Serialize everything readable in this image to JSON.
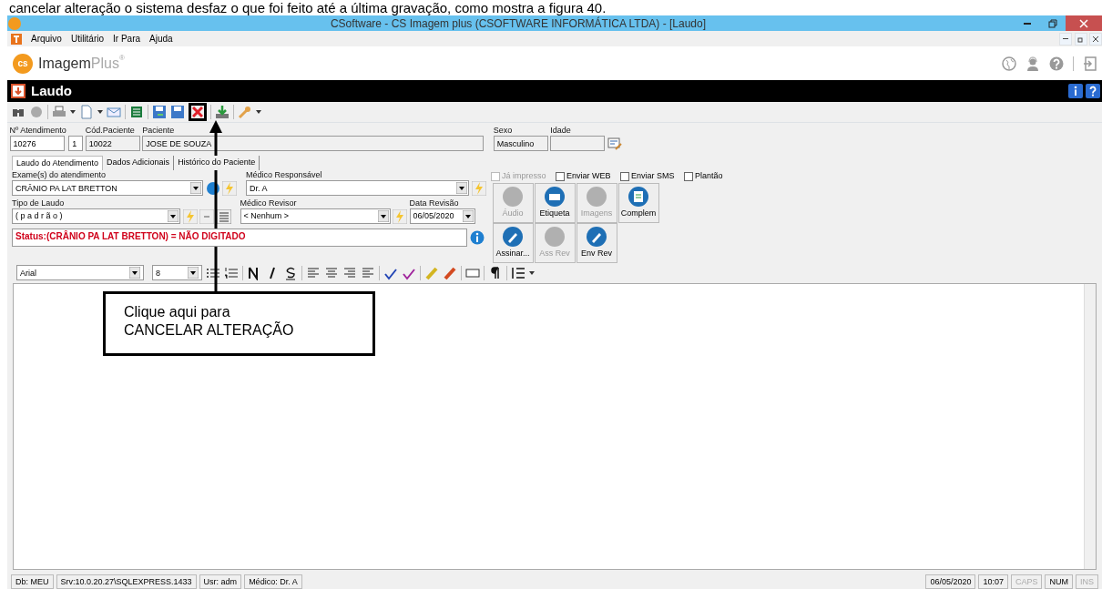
{
  "document_text": "cancelar alteração o sistema desfaz o que foi feito até a última gravação, como mostra a figura 40.",
  "window": {
    "title": "CSoftware - CS Imagem plus (CSOFTWARE INFORMÁTICA LTDA) - [Laudo]"
  },
  "menu": [
    "Arquivo",
    "Utilitário",
    "Ir Para",
    "Ajuda"
  ],
  "brand": {
    "logo": "cs",
    "name": "Imagem",
    "name_suffix": "Plus",
    "mark": "®"
  },
  "form": {
    "title": "Laudo"
  },
  "patient": {
    "fields": [
      {
        "label": "Nº Atendimento",
        "value": "10276",
        "kind": "edit"
      },
      {
        "value": "1",
        "kind": "edit"
      },
      {
        "label": "Cód.Paciente",
        "value": "10022",
        "kind": "readonly"
      },
      {
        "label": "Paciente",
        "value": "JOSE DE SOUZA",
        "kind": "readonly"
      },
      {
        "label": "Sexo",
        "value": "Masculino",
        "kind": "readonly"
      },
      {
        "label": "Idade",
        "kind": "readonly"
      }
    ]
  },
  "tabs": [
    {
      "label": "Laudo do Atendimento",
      "selected": true
    },
    {
      "label": "Dados Adicionais",
      "selected": false
    },
    {
      "label": "Histórico do Paciente",
      "selected": false
    }
  ],
  "exam": {
    "label": "Exame(s) do atendimento",
    "value": "CRÂNIO PA LAT BRETTON"
  },
  "tipo": {
    "label": "Tipo de Laudo",
    "value": "( p a d r ã o )"
  },
  "medico": {
    "label": "Médico Responsável",
    "value": "Dr. A"
  },
  "revisor": {
    "label": "Médico Revisor",
    "value": "< Nenhum >"
  },
  "data_revisao": {
    "label": "Data Revisão",
    "value": "06/05/2020"
  },
  "checkboxes": [
    {
      "label": "Já impresso",
      "checked": false,
      "disabled": true
    },
    {
      "label": "Enviar WEB",
      "checked": false,
      "disabled": false
    },
    {
      "label": "Enviar SMS",
      "checked": false,
      "disabled": false
    },
    {
      "label": "Plantão",
      "checked": false,
      "disabled": false
    }
  ],
  "action_buttons": [
    {
      "label": "Áudio",
      "disabled": true,
      "kind": "inactive"
    },
    {
      "label": "Etiqueta",
      "disabled": false,
      "kind": "print"
    },
    {
      "label": "Imagens",
      "disabled": true,
      "kind": "inactive"
    },
    {
      "label": "Complem",
      "disabled": false,
      "kind": "document"
    },
    {
      "label": "Assinar...",
      "disabled": false,
      "kind": "sign"
    },
    {
      "label": "Ass Rev",
      "disabled": true,
      "kind": "inactive"
    },
    {
      "label": "Env Rev",
      "disabled": false,
      "kind": "sign"
    }
  ],
  "status": "Status:(CRÂNIO PA LAT BRETTON) = NÃO DIGITADO",
  "editor": {
    "font": "Arial",
    "size": "8"
  },
  "callout": {
    "lines": [
      "Clique aqui para",
      "CANCELAR ALTERAÇÃO"
    ]
  },
  "status_bar": {
    "left": [
      {
        "text": "Db: MEU",
        "disabled": false
      },
      {
        "text": "Srv:10.0.20.27\\SQLEXPRESS.1433",
        "disabled": false
      },
      {
        "text": "Usr: adm",
        "disabled": false
      },
      {
        "text": "Médico: Dr. A",
        "disabled": false
      }
    ],
    "right": [
      {
        "text": "06/05/2020",
        "disabled": false
      },
      {
        "text": "10:07",
        "disabled": false
      },
      {
        "text": "CAPS",
        "disabled": true
      },
      {
        "text": "NUM",
        "disabled": false
      },
      {
        "text": "INS",
        "disabled": true
      }
    ]
  }
}
